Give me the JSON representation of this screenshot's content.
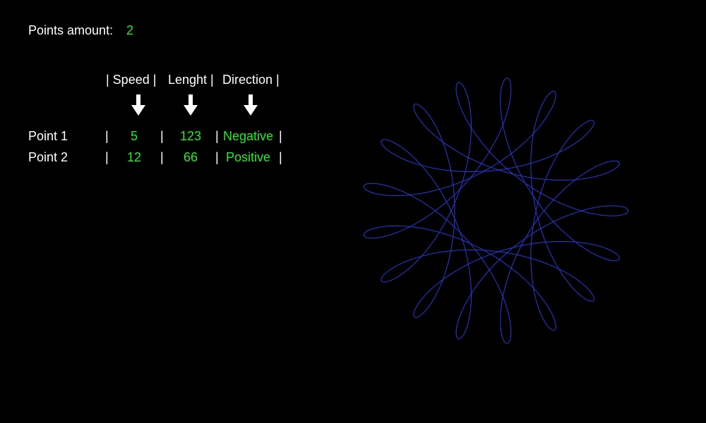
{
  "header": {
    "points_amount_label": "Points amount:",
    "points_amount_value": "2"
  },
  "table": {
    "headers": {
      "speed": "| Speed |",
      "length": "Lenght |",
      "direction": "Direction |"
    },
    "arrow_icon": "arrow-down-icon",
    "separator": "|",
    "rows": [
      {
        "label": "Point 1",
        "speed": "5",
        "length": "123",
        "direction": "Negative"
      },
      {
        "label": "Point 2",
        "speed": "12",
        "length": "66",
        "direction": "Positive"
      }
    ]
  },
  "colors": {
    "background": "#000000",
    "text": "#ffffff",
    "value": "#22ee22",
    "curve": "#2a3ad8"
  },
  "curve": {
    "points": [
      {
        "speed": 5,
        "length": 123,
        "direction": -1
      },
      {
        "speed": 12,
        "length": 66,
        "direction": 1
      }
    ]
  }
}
